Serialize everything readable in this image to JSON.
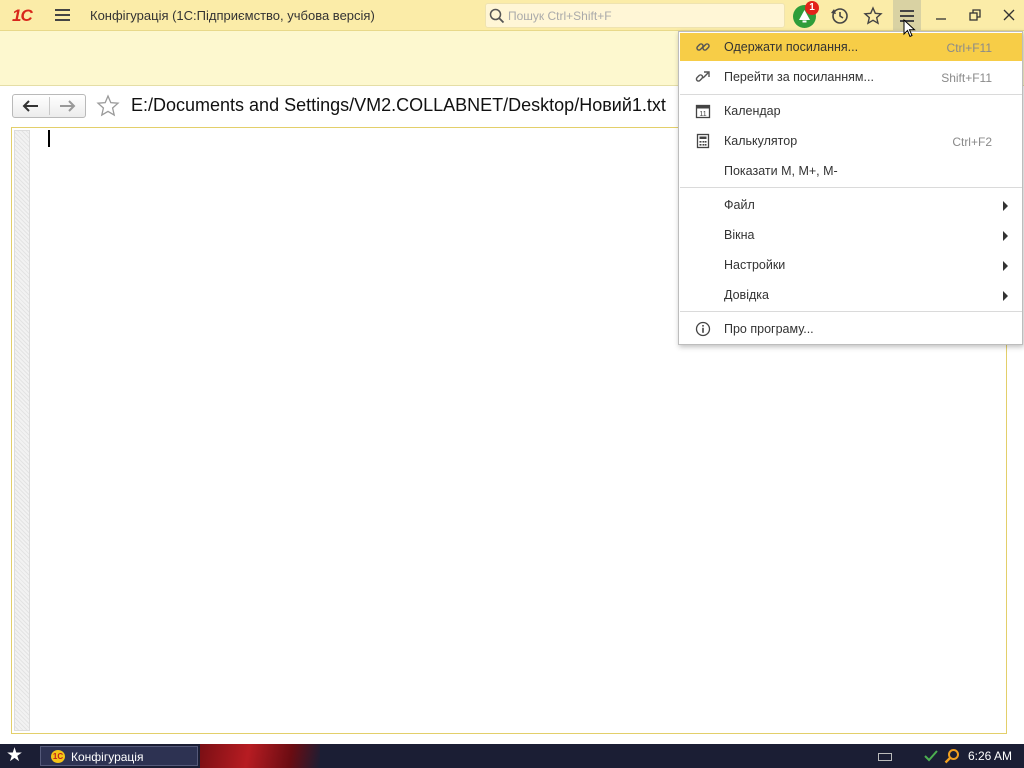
{
  "titlebar": {
    "logo": "1С",
    "title": "Конфігурація  (1С:Підприємство, учбова версія)",
    "search_placeholder": "Пошук Ctrl+Shift+F",
    "notification_count": "1"
  },
  "navbar": {
    "path": "E:/Documents and Settings/VM2.COLLABNET/Desktop/Новий1.txt"
  },
  "menu": {
    "items": [
      {
        "label": "Одержати посилання...",
        "shortcut": "Ctrl+F11",
        "icon": "link-icon",
        "active": true
      },
      {
        "label": "Перейти за посиланням...",
        "shortcut": "Shift+F11",
        "icon": "goto-link-icon"
      },
      {
        "label": "Календар",
        "shortcut": "",
        "icon": "calendar-icon"
      },
      {
        "label": "Калькулятор",
        "shortcut": "Ctrl+F2",
        "icon": "calculator-icon"
      },
      {
        "label": "Показати M, M+, M-",
        "shortcut": ""
      },
      {
        "label": "Файл",
        "submenu": true
      },
      {
        "label": "Вікна",
        "submenu": true
      },
      {
        "label": "Настройки",
        "submenu": true
      },
      {
        "label": "Довідка",
        "submenu": true
      },
      {
        "label": "Про програму...",
        "icon": "info-icon"
      }
    ]
  },
  "taskbar": {
    "task_logo": "1С",
    "task_label": "Конфігурація",
    "clock": "6:26 AM"
  },
  "colors": {
    "titlebar_bg": "#fbeca8",
    "form_bg": "#fdf8cf",
    "menu_active": "#f7cd47",
    "logo_red": "#d8271c"
  }
}
